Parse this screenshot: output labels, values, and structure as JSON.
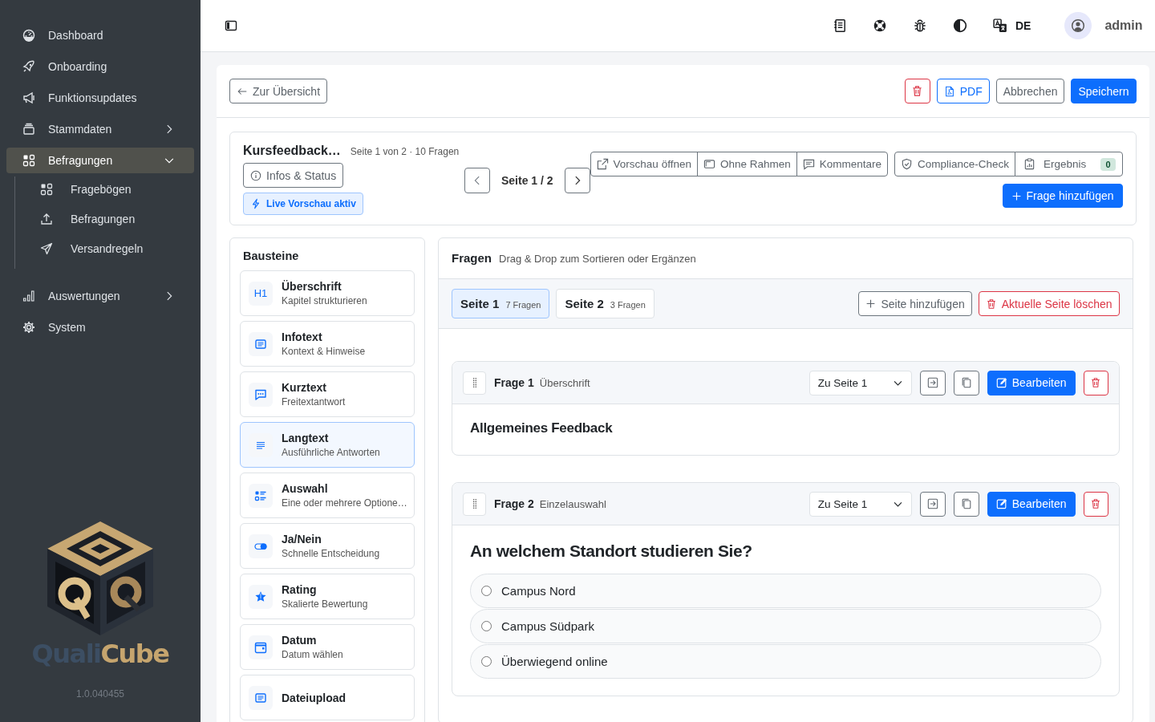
{
  "sidebar": {
    "items": [
      {
        "label": "Dashboard",
        "selected": false
      },
      {
        "label": "Onboarding",
        "selected": false
      },
      {
        "label": "Funktionsupdates",
        "selected": false
      },
      {
        "label": "Stammdaten",
        "selected": false,
        "expanded": false
      },
      {
        "label": "Befragungen",
        "selected": true,
        "expanded": true,
        "children": [
          {
            "label": "Fragebögen"
          },
          {
            "label": "Befragungen"
          },
          {
            "label": "Versandregeln"
          }
        ]
      },
      {
        "label": "Auswertungen",
        "selected": false,
        "expanded": false
      },
      {
        "label": "System",
        "selected": false
      }
    ],
    "logo": {
      "text_first": "Quali",
      "text_second": "Cube"
    },
    "version": "1.0.040455"
  },
  "topbar": {
    "language": "DE",
    "user": "admin"
  },
  "toolbar": {
    "back": "Zur Übersicht",
    "pdf": "PDF",
    "cancel": "Abbrechen",
    "save": "Speichern"
  },
  "survey": {
    "title": "Kursfeedback…",
    "meta": "Seite 1 von 2 · 10 Fragen",
    "info_button": "Infos & Status",
    "live_badge": "Live Vorschau aktiv",
    "pager": "Seite 1 / 2",
    "view_buttons": [
      "Vorschau öffnen",
      "Ohne Rahmen",
      "Kommentare"
    ],
    "check_buttons": [
      "Compliance-Check",
      "Ergebnis"
    ],
    "result_count": "0",
    "add_question": "Frage hinzufügen"
  },
  "blocks": {
    "title": "Bausteine",
    "items": [
      {
        "label": "Überschrift",
        "hint": "Kapitel strukturieren",
        "icon_text": "H1",
        "selected": false
      },
      {
        "label": "Infotext",
        "hint": "Kontext & Hinweise",
        "selected": false
      },
      {
        "label": "Kurztext",
        "hint": "Freitextantwort",
        "selected": false
      },
      {
        "label": "Langtext",
        "hint": "Ausführliche Antworten",
        "selected": true
      },
      {
        "label": "Auswahl",
        "hint": "Eine oder mehrere Optione…",
        "selected": false
      },
      {
        "label": "Ja/Nein",
        "hint": "Schnelle Entscheidung",
        "selected": false
      },
      {
        "label": "Rating",
        "hint": "Skalierte Bewertung",
        "selected": false
      },
      {
        "label": "Datum",
        "hint": "Datum wählen",
        "selected": false
      },
      {
        "label": "Dateiupload",
        "selected": false
      }
    ]
  },
  "questions": {
    "title": "Fragen",
    "hint": "Drag & Drop zum Sortieren oder Ergänzen",
    "pages": [
      {
        "label": "Seite 1",
        "count": "7 Fragen",
        "selected": true
      },
      {
        "label": "Seite 2",
        "count": "3 Fragen",
        "selected": false
      }
    ],
    "add_page": "Seite hinzufügen",
    "delete_page": "Aktuelle Seite löschen",
    "items": [
      {
        "kind": "heading",
        "number": "Frage 1",
        "type": "Überschrift",
        "target": "Zu Seite 1",
        "edit": "Bearbeiten",
        "text": "Allgemeines Feedback"
      },
      {
        "kind": "single_choice",
        "number": "Frage 2",
        "type": "Einzelauswahl",
        "target": "Zu Seite 1",
        "edit": "Bearbeiten",
        "text": "An welchem Standort studieren Sie?",
        "options": [
          {
            "label": "Campus Nord",
            "selected": false
          },
          {
            "label": "Campus Südpark",
            "selected": false
          },
          {
            "label": "Überwiegend online",
            "selected": false
          }
        ]
      }
    ]
  }
}
